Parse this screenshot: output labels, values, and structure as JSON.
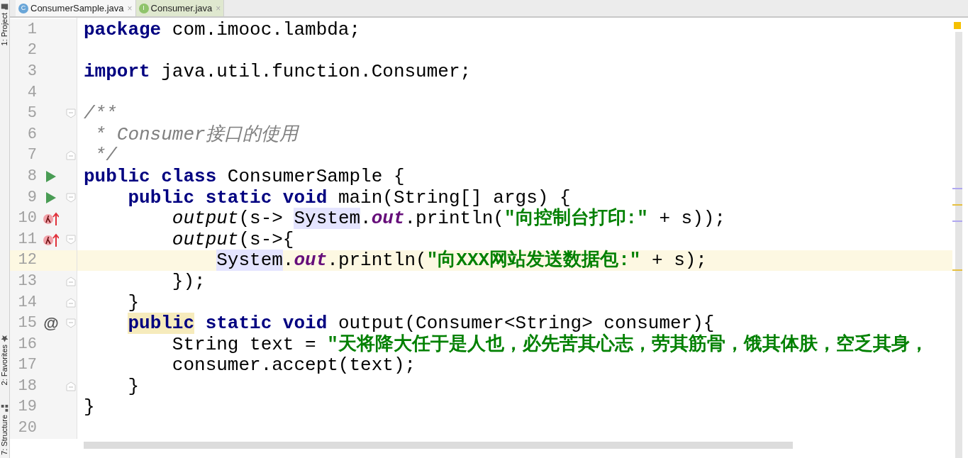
{
  "tool_strip": {
    "top": [
      {
        "label": "1: Project"
      }
    ],
    "bottom": [
      {
        "label": "2: Favorites"
      },
      {
        "label": "7: Structure"
      }
    ]
  },
  "tabs": [
    {
      "label": "ConsumerSample.java",
      "selected": true,
      "icon": {
        "kind": "class",
        "letter": "C"
      },
      "close": "×"
    },
    {
      "label": "Consumer.java",
      "selected": false,
      "icon": {
        "kind": "interface",
        "letter": "I"
      },
      "close": "×"
    }
  ],
  "editor": {
    "lines": [
      {
        "number": "1",
        "current": false,
        "tokens": [
          {
            "kind": "keyword",
            "text": "package"
          },
          {
            "kind": "plain",
            "text": " com.imooc.lambda;"
          }
        ]
      },
      {
        "number": "2",
        "current": false
      },
      {
        "number": "3",
        "current": false,
        "tokens": [
          {
            "kind": "keyword",
            "text": "import"
          },
          {
            "kind": "plain",
            "text": " java.util.function.Consumer;"
          }
        ]
      },
      {
        "number": "4",
        "current": false
      },
      {
        "number": "5",
        "current": false,
        "fold": {
          "kind": "start"
        },
        "tokens": [
          {
            "kind": "comment",
            "text": "/**"
          }
        ]
      },
      {
        "number": "6",
        "current": false,
        "tokens": [
          {
            "kind": "comment",
            "text": " * Consumer接口的使用"
          }
        ]
      },
      {
        "number": "7",
        "current": false,
        "fold": {
          "kind": "end"
        },
        "tokens": [
          {
            "kind": "comment",
            "text": " */"
          }
        ]
      },
      {
        "number": "8",
        "current": false,
        "marker": {
          "kind": "run"
        },
        "tokens": [
          {
            "kind": "keyword",
            "text": "public class"
          },
          {
            "kind": "plain",
            "text": " ConsumerSample {"
          }
        ]
      },
      {
        "number": "9",
        "current": false,
        "marker": {
          "kind": "run"
        },
        "fold": {
          "kind": "start"
        },
        "tokens": [
          {
            "kind": "keyword",
            "text": "    public static void"
          },
          {
            "kind": "plain",
            "text": " main(String[] args) {"
          }
        ]
      },
      {
        "number": "10",
        "current": false,
        "marker": {
          "kind": "lambda"
        },
        "tokens": [
          {
            "kind": "method",
            "text": "        output"
          },
          {
            "kind": "plain",
            "text": "(s-> "
          },
          {
            "kind": "usage",
            "text": "System"
          },
          {
            "kind": "plain",
            "text": "."
          },
          {
            "kind": "field",
            "text": "out"
          },
          {
            "kind": "plain",
            "text": ".println("
          },
          {
            "kind": "string",
            "text": "\"向控制台打印:\""
          },
          {
            "kind": "plain",
            "text": " + s));"
          }
        ]
      },
      {
        "number": "11",
        "current": false,
        "marker": {
          "kind": "lambda"
        },
        "fold": {
          "kind": "start"
        },
        "tokens": [
          {
            "kind": "method",
            "text": "        output"
          },
          {
            "kind": "plain",
            "text": "(s->{"
          }
        ]
      },
      {
        "number": "12",
        "current": true,
        "tokens": [
          {
            "kind": "usage",
            "text": "            System"
          },
          {
            "kind": "plain",
            "text": "."
          },
          {
            "kind": "field",
            "text": "out"
          },
          {
            "kind": "plain",
            "text": ".println("
          },
          {
            "kind": "string",
            "text": "\"向XXX网站发送数据包:\""
          },
          {
            "kind": "plain",
            "text": " + s);"
          }
        ]
      },
      {
        "number": "13",
        "current": false,
        "fold": {
          "kind": "end"
        },
        "tokens": [
          {
            "kind": "plain",
            "text": "        });"
          }
        ]
      },
      {
        "number": "14",
        "current": false,
        "fold": {
          "kind": "end"
        },
        "tokens": [
          {
            "kind": "plain",
            "text": "    }"
          }
        ]
      },
      {
        "number": "15",
        "current": false,
        "marker": {
          "kind": "text",
          "text": "@"
        },
        "fold": {
          "kind": "start"
        },
        "tokens": [
          {
            "kind": "keyword-highlight",
            "text": "    public"
          },
          {
            "kind": "keyword",
            "text": " static void"
          },
          {
            "kind": "plain",
            "text": " output(Consumer<String> consumer){"
          }
        ]
      },
      {
        "number": "16",
        "current": false,
        "tokens": [
          {
            "kind": "plain",
            "text": "        String text = "
          },
          {
            "kind": "string",
            "text": "\"天将降大任于是人也，必先苦其心志，劳其筋骨，饿其体肤，空乏其身，"
          }
        ]
      },
      {
        "number": "17",
        "current": false,
        "tokens": [
          {
            "kind": "plain",
            "text": "        consumer.accept(text);"
          }
        ]
      },
      {
        "number": "18",
        "current": false,
        "fold": {
          "kind": "end"
        },
        "tokens": [
          {
            "kind": "plain",
            "text": "    }"
          }
        ]
      },
      {
        "number": "19",
        "current": false,
        "tokens": [
          {
            "kind": "plain",
            "text": "}"
          }
        ]
      },
      {
        "number": "20",
        "current": false
      }
    ]
  }
}
